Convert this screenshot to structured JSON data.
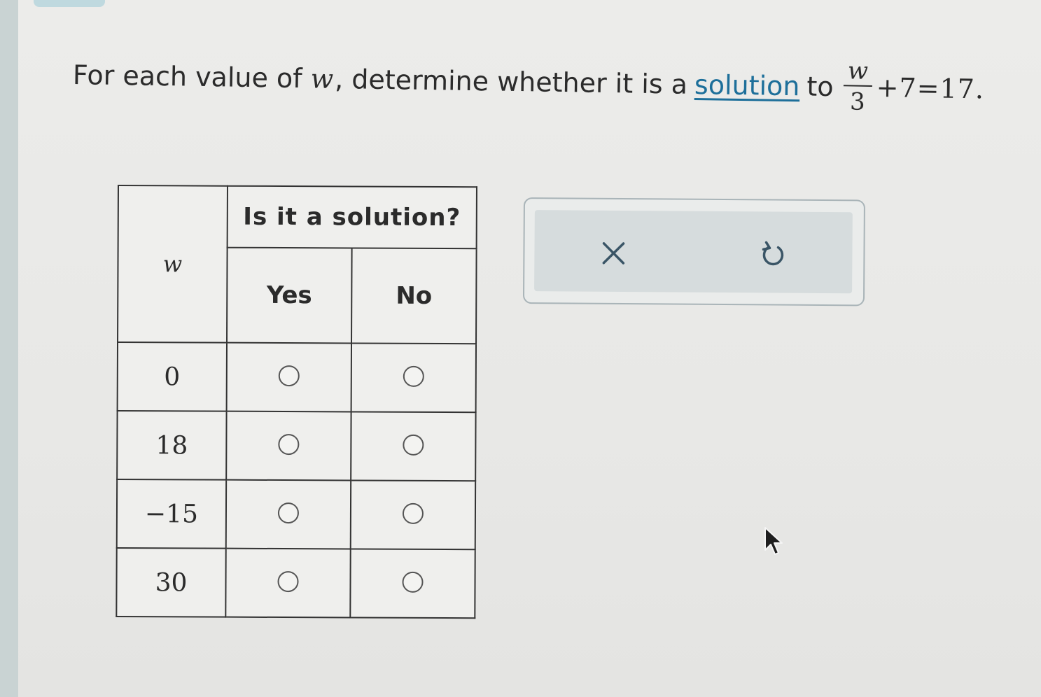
{
  "question": {
    "prefix": "For each value of",
    "variable": "w",
    "middle": ", determine whether it is a",
    "link_text": "solution",
    "suffix": "to",
    "equation": {
      "numerator": "w",
      "denominator": "3",
      "rest": "+7=17."
    }
  },
  "table": {
    "var_header": "w",
    "group_header": "Is it a solution?",
    "option_headers": [
      "Yes",
      "No"
    ],
    "rows": [
      {
        "w": "0"
      },
      {
        "w": "18"
      },
      {
        "w": "−15"
      },
      {
        "w": "30"
      }
    ]
  },
  "tools": {
    "clear_icon": "close-x",
    "undo_icon": "undo-arrow"
  }
}
